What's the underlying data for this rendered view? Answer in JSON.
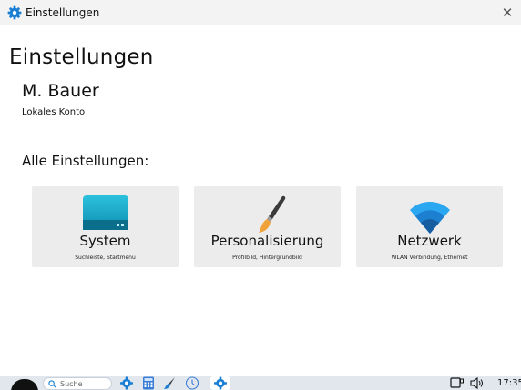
{
  "window": {
    "title": "Einstellungen",
    "icon": "gear-icon",
    "close_icon": "close-icon"
  },
  "main": {
    "page_title": "Einstellungen",
    "account_name": "M. Bauer",
    "account_type": "Lokales Konto",
    "section_heading": "Alle Einstellungen:"
  },
  "tiles": [
    {
      "label": "System",
      "subtitle": "Suchleiste, Startmenü",
      "icon": "monitor-icon"
    },
    {
      "label": "Personalisierung",
      "subtitle": "Profilbild, Hintergrundbild",
      "icon": "brush-icon"
    },
    {
      "label": "Netzwerk",
      "subtitle": "WLAN Verbindung, Ethernet",
      "icon": "wifi-icon"
    }
  ],
  "taskbar": {
    "search_placeholder": "Suche",
    "apps": [
      "gear-icon",
      "calculator-icon",
      "brush-icon",
      "clock-icon",
      "gear-icon"
    ],
    "clock": "17:35"
  },
  "colors": {
    "accent": "#1a7fd4",
    "tile_bg": "#ececec",
    "taskbar_bg": "#e2e7ee",
    "system_icon": "#17a7c6",
    "wifi_icon": "#1f8fe0"
  }
}
